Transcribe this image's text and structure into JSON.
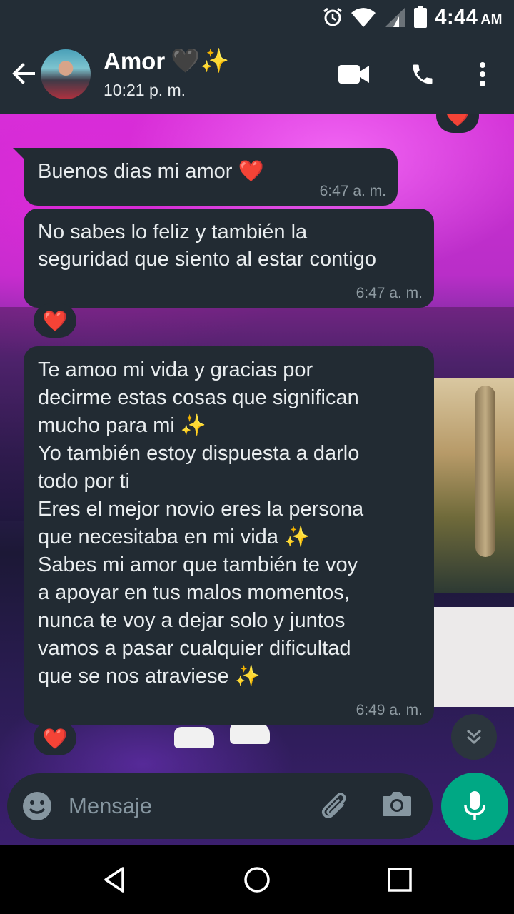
{
  "status_bar": {
    "time": "4:44",
    "ampm": "AM",
    "icons": [
      "alarm-icon",
      "wifi-icon",
      "signal-icon",
      "battery-icon"
    ]
  },
  "header": {
    "contact_name": "Amor",
    "name_emojis": "🖤✨",
    "last_seen": "10:21 p. m.",
    "icons": [
      "back-arrow-icon",
      "video-call-icon",
      "phone-icon",
      "more-vert-icon"
    ]
  },
  "messages": [
    {
      "text": "Buenos dias mi amor ❤️",
      "time": "6:47 a. m."
    },
    {
      "text": "No sabes lo feliz y también la\nseguridad que siento al estar contigo",
      "time": "6:47 a. m.",
      "reaction": "❤️"
    },
    {
      "text": "Te amoo mi vida y gracias por\ndecirme estas cosas que significan\nmucho para mi ✨\nYo también estoy dispuesta a darlo\ntodo por ti\nEres el mejor novio eres la persona\nque necesitaba en mi vida ✨\nSabes mi amor que también te voy\na apoyar en tus malos momentos,\nnunca te voy a dejar solo y juntos\nvamos a pasar cualquier dificultad\nque se nos atraviese ✨",
      "time": "6:49 a. m.",
      "reaction": "❤️"
    }
  ],
  "top_reaction": "❤️",
  "composer": {
    "placeholder": "Mensaje",
    "icons": [
      "emoji-icon",
      "attach-icon",
      "camera-icon",
      "mic-icon"
    ]
  },
  "colors": {
    "header_bg": "#232d36",
    "bubble_bg": "#222b33",
    "accent": "#00a884",
    "time_text": "#8f9ba2"
  }
}
